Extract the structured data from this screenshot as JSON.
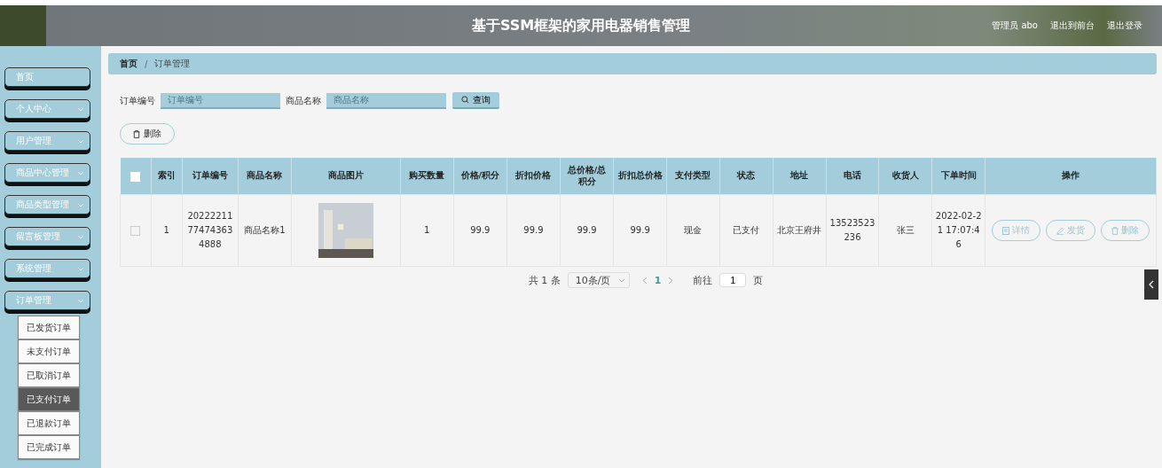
{
  "header": {
    "title": "基于SSM框架的家用电器销售管理",
    "user": "管理员 abo",
    "links": [
      "退出到前台",
      "退出登录"
    ]
  },
  "sidebar": {
    "items": [
      {
        "label": "首页",
        "kind": "link"
      },
      {
        "label": "个人中心",
        "kind": "menu"
      },
      {
        "label": "用户管理",
        "kind": "menu"
      },
      {
        "label": "商品中心管理",
        "kind": "menu"
      },
      {
        "label": "商品类型管理",
        "kind": "menu"
      },
      {
        "label": "留言板管理",
        "kind": "menu"
      },
      {
        "label": "系统管理",
        "kind": "menu"
      },
      {
        "label": "订单管理",
        "kind": "menu",
        "children": [
          {
            "label": "已发货订单",
            "selected": false
          },
          {
            "label": "未支付订单",
            "selected": false
          },
          {
            "label": "已取消订单",
            "selected": false
          },
          {
            "label": "已支付订单",
            "selected": true
          },
          {
            "label": "已退款订单",
            "selected": false
          },
          {
            "label": "已完成订单",
            "selected": false
          }
        ]
      }
    ]
  },
  "breadcrumb": {
    "items": [
      "首页",
      "订单管理"
    ],
    "separator": "/"
  },
  "search": {
    "fields": [
      {
        "label": "订单编号",
        "placeholder": "订单编号"
      },
      {
        "label": "商品名称",
        "placeholder": "商品名称"
      }
    ],
    "button": "查询"
  },
  "delete_button": "删除",
  "table": {
    "select_all": {
      "checked": false
    },
    "columns": [
      "索引",
      "订单编号",
      "商品名称",
      "商品图片",
      "购买数量",
      "价格/积分",
      "折扣价格",
      "总价格/总积分",
      "折扣总价格",
      "支付类型",
      "状态",
      "地址",
      "电话",
      "收货人",
      "下单时间",
      "操作"
    ],
    "rows": [
      {
        "checked": false,
        "cells": [
          "1",
          "20222211774743634888",
          "商品名称1",
          null,
          "1",
          "99.9",
          "99.9",
          "99.9",
          "99.9",
          "现金",
          "已支付",
          "北京王府井",
          "13523523236",
          "张三",
          "2022-02-21 17:07:46"
        ],
        "actions": [
          "详情",
          "发货",
          "删除"
        ]
      }
    ]
  },
  "pagination": {
    "total": "共 1 条",
    "page_size": "10条/页",
    "pages": [
      {
        "label": "1",
        "selected": true
      }
    ],
    "goto_label": "前往",
    "goto_value": "1",
    "goto_suffix": "页"
  }
}
